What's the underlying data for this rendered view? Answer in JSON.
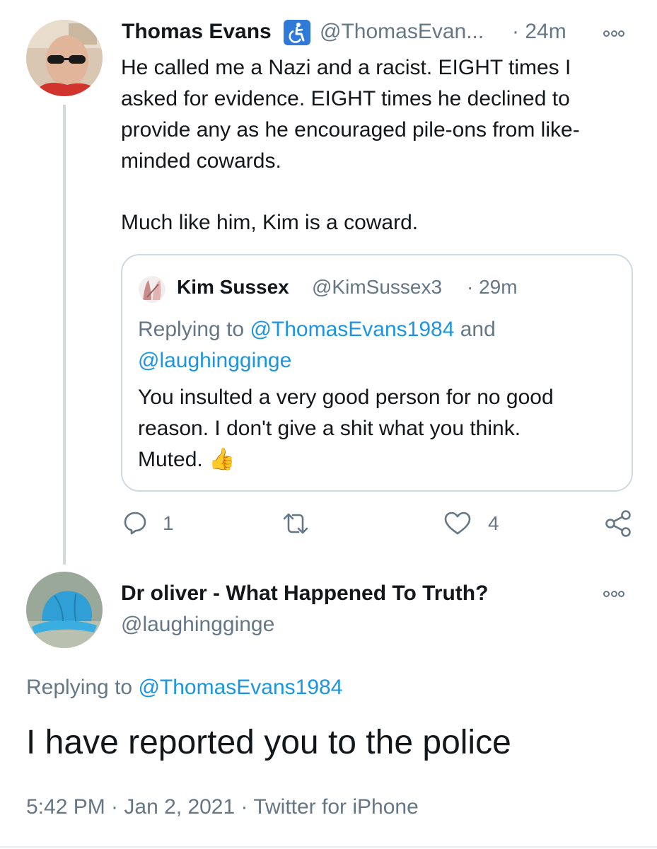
{
  "tweet": {
    "author_name": "Thomas Evans",
    "author_handle": "@ThomasEvan...",
    "time": "· 24m",
    "text_lines": [
      "He called me a Nazi and a racist. EIGHT times I",
      "asked for evidence. EIGHT times he declined to",
      "provide any as he encouraged pile-ons from like-",
      "minded cowards."
    ],
    "text_closing": "Much like him, Kim is a coward.",
    "badge_icon": "accessible-icon",
    "quoted": {
      "author_name": "Kim Sussex",
      "author_handle": "@KimSussex3",
      "time": "· 29m",
      "replying_prefix": "Replying to",
      "replying_handle_1": "@ThomasEvans1984",
      "replying_and": "and",
      "replying_handle_2": "@laughingginge",
      "text_lines": [
        "You insulted a very good person for no good",
        "reason. I don't give a shit what you think.",
        "Muted."
      ],
      "emoji": "👍"
    },
    "actions": {
      "reply_count": "1",
      "retweet_count": "",
      "like_count": "4"
    }
  },
  "reply": {
    "author_name": "Dr oliver - What Happened To Truth?",
    "author_handle": "@laughingginge",
    "replying_prefix": "Replying to",
    "replying_handle": "@ThomasEvans1984",
    "text": "I have reported you to the police",
    "timestamp": "5:42 PM · Jan 2, 2021",
    "separator": "·",
    "client": "Twitter for iPhone"
  },
  "colors": {
    "accent": "#1b95e0",
    "muted": "#657786",
    "text": "#14171a",
    "border": "#cfd9de"
  }
}
